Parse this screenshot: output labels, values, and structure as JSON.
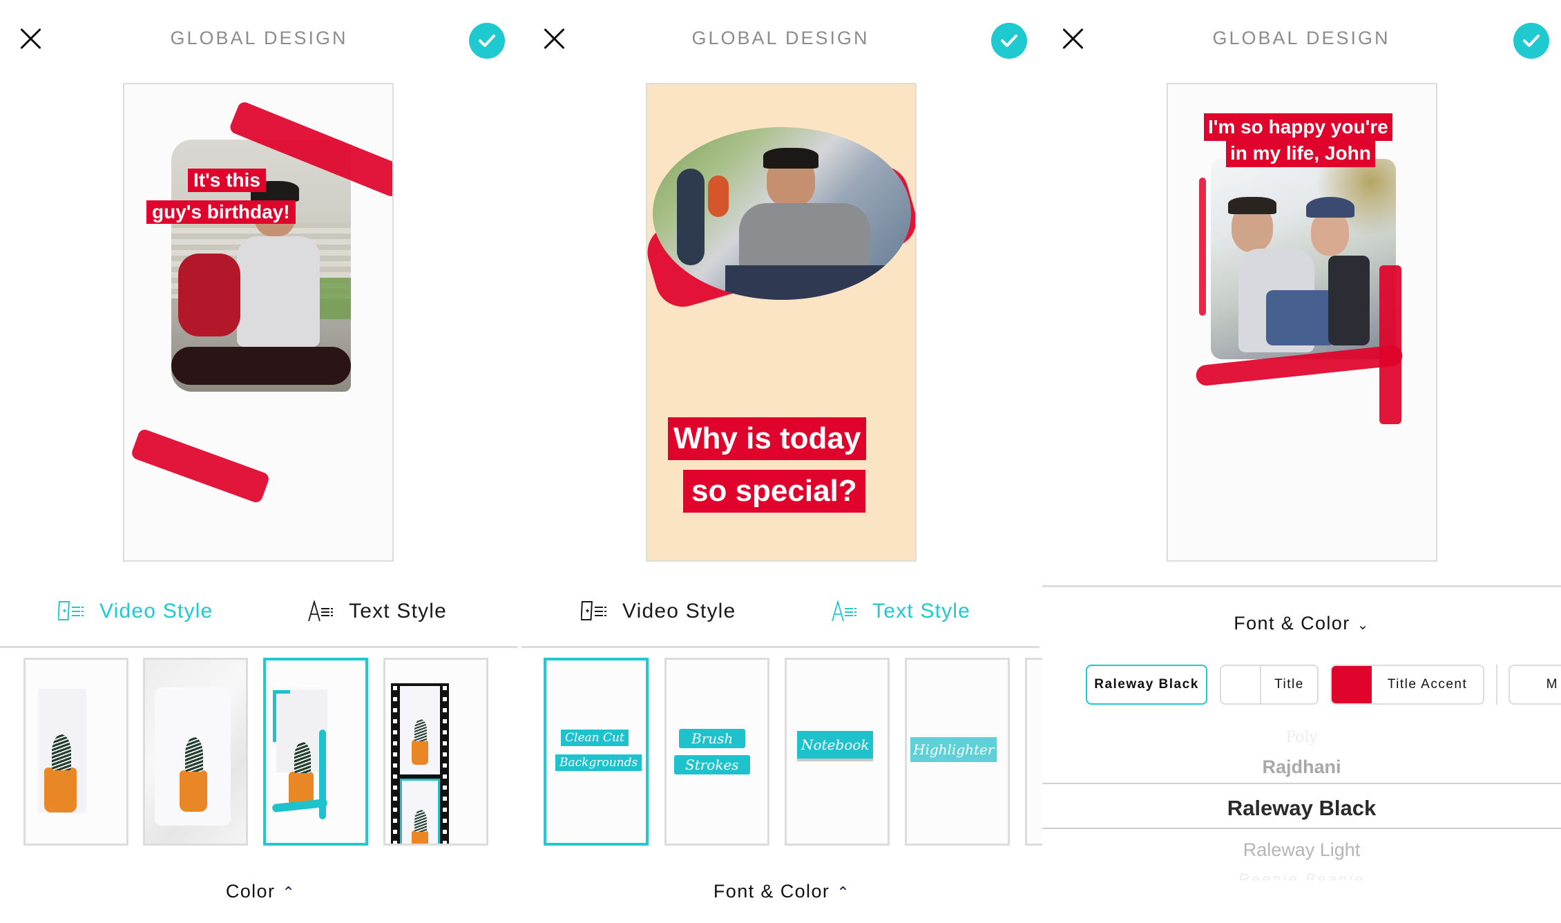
{
  "colors": {
    "accent": "#1ec9cf",
    "brand_red": "#e0032b",
    "beige": "#fbe4c4"
  },
  "header": {
    "title": "GLOBAL DESIGN",
    "close_icon": "close-icon",
    "confirm_icon": "checkmark-icon"
  },
  "tabs": {
    "video_style": "Video Style",
    "text_style": "Text Style"
  },
  "panel1": {
    "active_tab": "video_style",
    "preview": {
      "caption_line1": "It's this",
      "caption_line2": "guy's birthday!"
    },
    "thumbnails": [
      {
        "name": "plain",
        "selected": false
      },
      {
        "name": "paper",
        "selected": false
      },
      {
        "name": "brush-frame",
        "selected": true
      },
      {
        "name": "film-strip",
        "selected": false
      }
    ],
    "bottom_label": "Color",
    "bottom_chevron": "^"
  },
  "panel2": {
    "active_tab": "text_style",
    "preview": {
      "caption_line1": "Why is today",
      "caption_line2": "so special?"
    },
    "text_styles": [
      {
        "lines": [
          "Clean Cut",
          "Backgrounds"
        ],
        "selected": true
      },
      {
        "lines": [
          "Brush",
          "Strokes"
        ],
        "selected": false
      },
      {
        "lines": [
          "Notebook"
        ],
        "selected": false
      },
      {
        "lines": [
          "Highlighter"
        ],
        "selected": false
      }
    ],
    "bottom_label": "Font & Color",
    "bottom_chevron": "^"
  },
  "panel3": {
    "preview": {
      "caption_line1": "I'm so happy you're",
      "caption_line2": "in my life, John"
    },
    "section_label": "Font & Color",
    "section_chevron": "v",
    "chips": [
      {
        "label": "Raleway Black",
        "selected": true
      },
      {
        "label": "Title",
        "swatch": "#ffffff"
      },
      {
        "label": "Title Accent",
        "swatch": "#e0032b"
      },
      {
        "label": "M"
      }
    ],
    "font_picker": {
      "items": [
        "Poly",
        "Rajdhani",
        "Raleway Black",
        "Raleway Light",
        "Reenie Beanie"
      ],
      "selected": "Raleway Black"
    }
  }
}
